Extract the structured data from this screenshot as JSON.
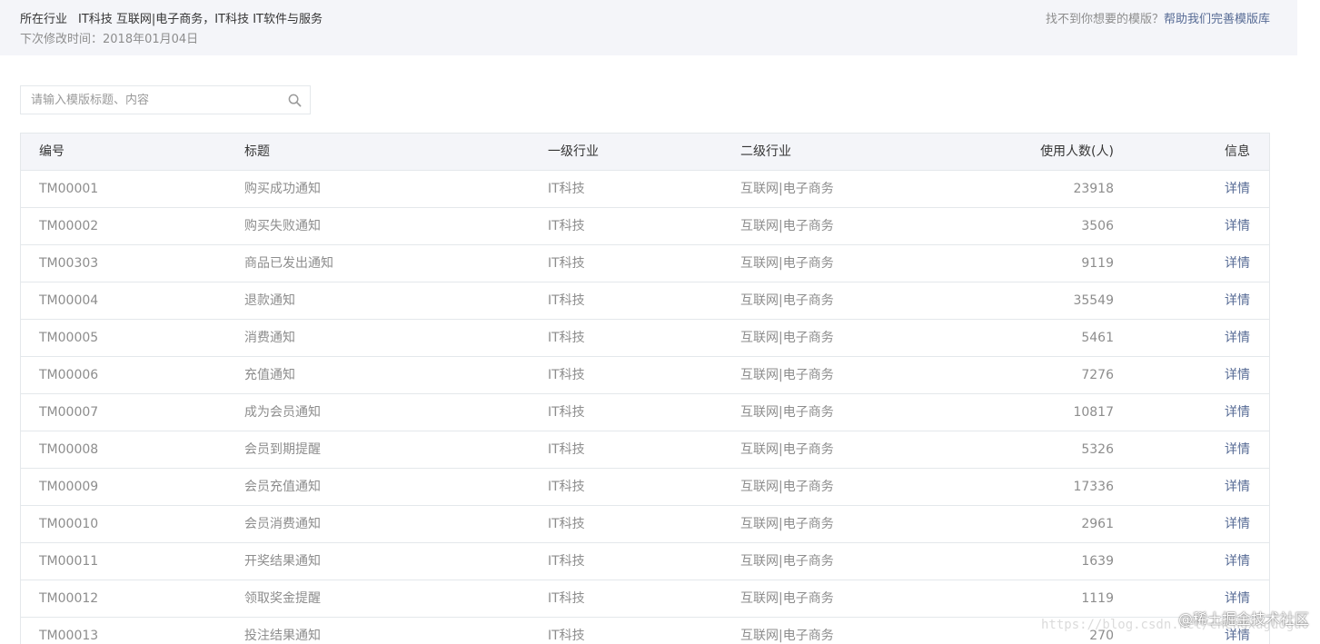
{
  "info_bar": {
    "industry_label": "所在行业",
    "industry_value": "IT科技 互联网|电子商务，IT科技 IT软件与服务",
    "modified_text": "下次修改时间：2018年01月04日",
    "help_prefix": "找不到你想要的模版？",
    "help_link": "帮助我们完善模版库"
  },
  "search": {
    "placeholder": "请输入模版标题、内容",
    "value": ""
  },
  "table": {
    "headers": {
      "id": "编号",
      "title": "标题",
      "industry1": "一级行业",
      "industry2": "二级行业",
      "users": "使用人数(人)",
      "info": "信息"
    },
    "rows": [
      {
        "id": "TM00001",
        "title": "购买成功通知",
        "industry1": "IT科技",
        "industry2": "互联网|电子商务",
        "users": "23918",
        "info": "详情"
      },
      {
        "id": "TM00002",
        "title": "购买失败通知",
        "industry1": "IT科技",
        "industry2": "互联网|电子商务",
        "users": "3506",
        "info": "详情"
      },
      {
        "id": "TM00303",
        "title": "商品已发出通知",
        "industry1": "IT科技",
        "industry2": "互联网|电子商务",
        "users": "9119",
        "info": "详情"
      },
      {
        "id": "TM00004",
        "title": "退款通知",
        "industry1": "IT科技",
        "industry2": "互联网|电子商务",
        "users": "35549",
        "info": "详情"
      },
      {
        "id": "TM00005",
        "title": "消费通知",
        "industry1": "IT科技",
        "industry2": "互联网|电子商务",
        "users": "5461",
        "info": "详情"
      },
      {
        "id": "TM00006",
        "title": "充值通知",
        "industry1": "IT科技",
        "industry2": "互联网|电子商务",
        "users": "7276",
        "info": "详情"
      },
      {
        "id": "TM00007",
        "title": "成为会员通知",
        "industry1": "IT科技",
        "industry2": "互联网|电子商务",
        "users": "10817",
        "info": "详情"
      },
      {
        "id": "TM00008",
        "title": "会员到期提醒",
        "industry1": "IT科技",
        "industry2": "互联网|电子商务",
        "users": "5326",
        "info": "详情"
      },
      {
        "id": "TM00009",
        "title": "会员充值通知",
        "industry1": "IT科技",
        "industry2": "互联网|电子商务",
        "users": "17336",
        "info": "详情"
      },
      {
        "id": "TM00010",
        "title": "会员消费通知",
        "industry1": "IT科技",
        "industry2": "互联网|电子商务",
        "users": "2961",
        "info": "详情"
      },
      {
        "id": "TM00011",
        "title": "开奖结果通知",
        "industry1": "IT科技",
        "industry2": "互联网|电子商务",
        "users": "1639",
        "info": "详情"
      },
      {
        "id": "TM00012",
        "title": "领取奖金提醒",
        "industry1": "IT科技",
        "industry2": "互联网|电子商务",
        "users": "1119",
        "info": "详情"
      },
      {
        "id": "TM00013",
        "title": "投注结果通知",
        "industry1": "IT科技",
        "industry2": "互联网|电子商务",
        "users": "270",
        "info": "详情"
      }
    ]
  },
  "watermark": {
    "text": "@稀土掘金技术社区",
    "url": "https://blog.csdn.net/chengxuguoguo"
  },
  "icons": {
    "search": "search-icon"
  },
  "colors": {
    "link": "#576b95",
    "header_bg": "#f4f5f9",
    "border": "#e4e8eb"
  }
}
